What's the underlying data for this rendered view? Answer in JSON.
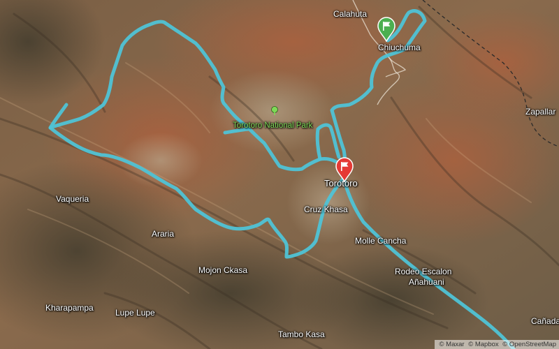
{
  "map": {
    "view": "satellite-terrain",
    "colors": {
      "route": "#4fc3d6",
      "start_marker": "#4caf50",
      "end_marker": "#e53935",
      "park_label": "#7ed957",
      "place_label": "#ffffff"
    }
  },
  "places": {
    "calahuta": "Calahuta",
    "chiuchuma": "Chiuchuma",
    "torotoro": "Torotoro",
    "cruz_khasa": "Cruz Khasa",
    "molle_cancha": "Molle Cancha",
    "rodeo_escalon": "Rodeo Escalon",
    "anahuani": "Añahuani",
    "vaqueria": "Vaqueria",
    "araria": "Araria",
    "mojon_ckasa": "Mojon Ckasa",
    "kharapampa": "Kharapampa",
    "lupe_lupe": "Lupe Lupe",
    "tambo_kasa": "Tambo Kasa",
    "zapallar": "Zapallar",
    "canada": "Cañada"
  },
  "park": {
    "label": "Torotoro National Park",
    "icon": "tree-icon"
  },
  "markers": {
    "start": {
      "icon": "flag-icon",
      "color": "green"
    },
    "end": {
      "icon": "flag-icon",
      "color": "red"
    }
  },
  "attribution": {
    "maxar": "© Maxar",
    "mapbox": "© Mapbox",
    "osm": "© OpenStreetMap"
  }
}
